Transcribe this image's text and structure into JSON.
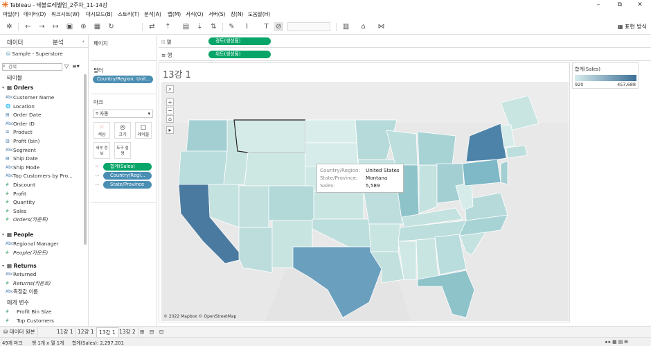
{
  "window": {
    "title": "Tableau - 테블로레벨업_2주차_11-14강",
    "minimize": "–",
    "restore": "⧉",
    "close": "✕"
  },
  "menu": [
    "파일(F)",
    "데이터(D)",
    "워크시트(W)",
    "대시보드(B)",
    "스토리(T)",
    "분석(A)",
    "맵(M)",
    "서식(O)",
    "서버(S)",
    "창(N)",
    "도움말(H)"
  ],
  "toolbar": {
    "show_me": "표현 방식"
  },
  "data_pane": {
    "tab_data": "데이터",
    "tab_analysis": "분석",
    "datasource": "Sample - Superstore",
    "search_placeholder": "검색",
    "tables_label": "테이블",
    "groups": [
      {
        "name": "Orders",
        "fields": [
          {
            "name": "Customer Name",
            "icon": "Abc"
          },
          {
            "name": "Location",
            "icon": "🌐"
          },
          {
            "name": "Order Date",
            "icon": "▤"
          },
          {
            "name": "Order ID",
            "icon": "Abc"
          },
          {
            "name": "Product",
            "icon": "⊞"
          },
          {
            "name": "Profit (bin)",
            "icon": "▥"
          },
          {
            "name": "Segment",
            "icon": "Abc"
          },
          {
            "name": "Ship Date",
            "icon": "▤"
          },
          {
            "name": "Ship Mode",
            "icon": "Abc"
          },
          {
            "name": "Top Customers by Pro...",
            "icon": "Abc"
          },
          {
            "name": "Discount",
            "icon": "#"
          },
          {
            "name": "Profit",
            "icon": "#"
          },
          {
            "name": "Quantity",
            "icon": "#"
          },
          {
            "name": "Sales",
            "icon": "#"
          },
          {
            "name": "Orders(카운트)",
            "icon": "#"
          }
        ]
      },
      {
        "name": "People",
        "fields": [
          {
            "name": "Regional Manager",
            "icon": "Abc"
          },
          {
            "name": "People(카운트)",
            "icon": "#"
          }
        ]
      },
      {
        "name": "Returns",
        "fields": [
          {
            "name": "Returned",
            "icon": "Abc"
          },
          {
            "name": "Returns(카운트)",
            "icon": "#"
          },
          {
            "name": "측정값 이름",
            "icon": "Abc"
          }
        ]
      }
    ],
    "params_label": "매개 변수",
    "params": [
      "Profit Bin Size",
      "Top Customers"
    ]
  },
  "cards": {
    "pages": "페이지",
    "filters": "필터",
    "filter_pill": "Country/Region: Unit...",
    "marks": "마크",
    "mark_type": "자동",
    "mark_buttons": [
      "색상",
      "크기",
      "레이블",
      "세부 정보",
      "도구 설명"
    ],
    "mark_pills": [
      "합계(Sales)",
      "Country/Regi...",
      "State/Province"
    ]
  },
  "shelves": {
    "columns_label": "열",
    "columns_pill": "경도(생성됨)",
    "rows_label": "행",
    "rows_pill": "위도(생성됨)"
  },
  "view": {
    "title": "13강 1",
    "copyright": "© 2022 Mapbox © OpenStreetMap",
    "tooltip": [
      {
        "k": "Country/Region:",
        "v": "United States"
      },
      {
        "k": "State/Province:",
        "v": "Montana"
      },
      {
        "k": "Sales:",
        "v": "5,589"
      }
    ]
  },
  "legend": {
    "title": "합계(Sales)",
    "min": "920",
    "max": "457,688",
    "color_low": "#d6ecec",
    "color_high": "#3c6e97"
  },
  "tabs": {
    "datasource": "데이터 원본",
    "sheets": [
      "11강 1",
      "12강 1",
      "13강 1",
      "13강 2"
    ],
    "active": "13강 1"
  },
  "status": {
    "marks": "49개 마크",
    "rows": "행 1개 x 열 1개",
    "sum": "합계(Sales): 2,297,201"
  }
}
